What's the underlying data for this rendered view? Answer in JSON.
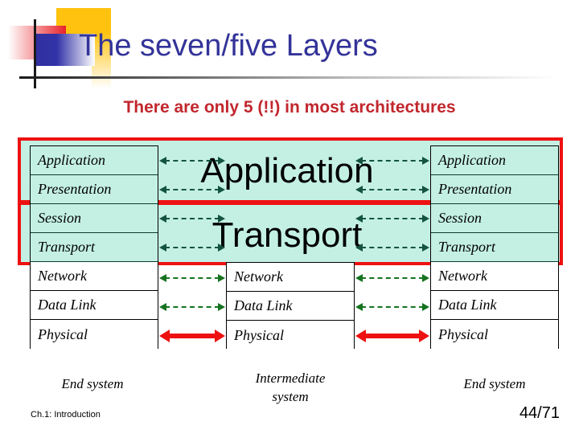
{
  "slide": {
    "title": "The seven/five Layers",
    "subtitle": "There are only 5 (!!) in most architectures",
    "title_color": "#333399",
    "subtitle_color": "#C1272D",
    "highlight_color": "#EE1111",
    "band_color": "#C4F0E4"
  },
  "stacks": {
    "left": {
      "caption": "End system",
      "layers": [
        {
          "label": "Application",
          "highlighted": true
        },
        {
          "label": "Presentation",
          "highlighted": true
        },
        {
          "label": "Session",
          "highlighted": true
        },
        {
          "label": "Transport",
          "highlighted": true
        },
        {
          "label": "Network",
          "highlighted": false
        },
        {
          "label": "Data Link",
          "highlighted": false
        },
        {
          "label": "Physical",
          "highlighted": false
        }
      ]
    },
    "center": {
      "caption": "Intermediate system",
      "caption_line1": "Intermediate",
      "caption_line2": "system",
      "big_labels": [
        "Application",
        "Transport"
      ],
      "layers": [
        {
          "label": "Network",
          "highlighted": false
        },
        {
          "label": "Data Link",
          "highlighted": false
        },
        {
          "label": "Physical",
          "highlighted": false
        }
      ]
    },
    "right": {
      "caption": "End system",
      "layers": [
        {
          "label": "Application",
          "highlighted": true
        },
        {
          "label": "Presentation",
          "highlighted": true
        },
        {
          "label": "Session",
          "highlighted": true
        },
        {
          "label": "Transport",
          "highlighted": true
        },
        {
          "label": "Network",
          "highlighted": false
        },
        {
          "label": "Data Link",
          "highlighted": false
        },
        {
          "label": "Physical",
          "highlighted": false
        }
      ]
    }
  },
  "arrows": {
    "styles": {
      "upper": {
        "kind": "dashed",
        "color": "#14543f"
      },
      "network": {
        "kind": "dashed",
        "color": "#15731f"
      },
      "datalink": {
        "kind": "dashed",
        "color": "#15731f"
      },
      "physical": {
        "kind": "solid",
        "color": "#EE1111"
      }
    }
  },
  "footer": {
    "chapter": "Ch.1: Introduction",
    "page": "44/71"
  }
}
